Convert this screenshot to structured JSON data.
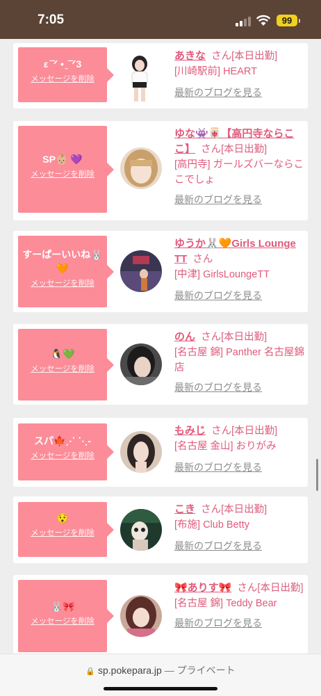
{
  "status": {
    "time": "7:05",
    "battery": "99"
  },
  "cards": [
    {
      "message": "ε ̄ ̄ᐟ • ̫ ̄ ̄ᐟ3",
      "delete_label": "メッセージを削除",
      "name": "あきな",
      "suffix": "さん[本日出勤]",
      "shop": "[川崎駅前] HEART",
      "blog": "最新のブログを見る"
    },
    {
      "message": "SP👶🏼 💜",
      "delete_label": "メッセージを削除",
      "name": "ゆな👾🀄【高円寺ならここ】",
      "suffix": "さん[本日出勤]",
      "shop": "[高円寺] ガールズバーならここでしょ",
      "blog": "最新のブログを見る"
    },
    {
      "message": "すーぱーいいね🐰🧡",
      "delete_label": "メッセージを削除",
      "name": "ゆうか🐰🧡Girls Lounge TT",
      "suffix": "さん",
      "shop": "[中津] GirlsLoungeTT",
      "blog": "最新のブログを見る"
    },
    {
      "message": "🐧💚",
      "delete_label": "メッセージを削除",
      "name": "のん",
      "suffix": "さん[本日出勤]",
      "shop": "[名古屋 錦] Panther 名古屋錦店",
      "blog": "最新のブログを見る"
    },
    {
      "message": "スパ🍁⋰ ⋱-",
      "delete_label": "メッセージを削除",
      "name": "もみじ",
      "suffix": "さん[本日出勤]",
      "shop": "[名古屋 金山] おりがみ",
      "blog": "最新のブログを見る"
    },
    {
      "message": "😯",
      "delete_label": "メッセージを削除",
      "name": "こき",
      "suffix": "さん[本日出勤]",
      "shop": "[布施] Club Betty",
      "blog": "最新のブログを見る"
    },
    {
      "message": "🐰🎀",
      "delete_label": "メッセージを削除",
      "name": "🎀ありす🎀",
      "suffix": "さん[本日出勤]",
      "shop": "[名古屋 錦] Teddy Bear",
      "blog": "最新のブログを見る"
    }
  ],
  "browser": {
    "url": "sp.pokepara.jp",
    "privacy": "— プライベート"
  },
  "colors": {
    "accent": "#fb8c98",
    "name_pink": "#e05a7c",
    "statusbar": "#5b4335",
    "battery": "#f2d01c"
  }
}
